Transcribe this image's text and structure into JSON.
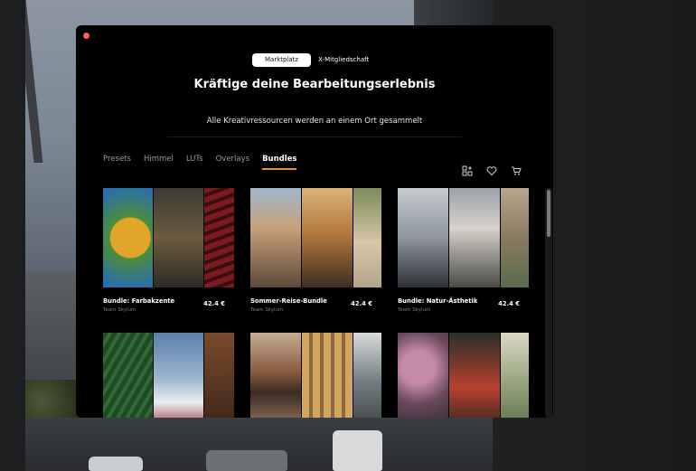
{
  "toggle": {
    "marketplace": "Marktplatz",
    "membership": "X-Mitgliedschaft"
  },
  "headline": "Kräftige deine Bearbeitungserlebnis",
  "subline": "Alle Kreativressourcen werden an einem Ort gesammelt",
  "tabs": [
    "Presets",
    "Himmel",
    "LUTs",
    "Overlays",
    "Bundles"
  ],
  "active_tab": "Bundles",
  "icons": [
    "apps-add-icon",
    "heart-icon",
    "cart-icon"
  ],
  "cards": [
    {
      "name": "Bundle: Farbakzente",
      "team": "Team Skylum",
      "price": "42.4 €"
    },
    {
      "name": "Sommer-Reise-Bundle",
      "team": "Team Skylum",
      "price": "42.4 €"
    },
    {
      "name": "Bundle: Natur-Ästhetik",
      "team": "Team Skylum",
      "price": "42.4 €"
    },
    {
      "name": "",
      "team": "",
      "price": ""
    },
    {
      "name": "",
      "team": "",
      "price": ""
    },
    {
      "name": "",
      "team": "",
      "price": ""
    }
  ],
  "colors": {
    "accent": "#e1913c",
    "close": "#ff5f57",
    "window": "#000000"
  }
}
